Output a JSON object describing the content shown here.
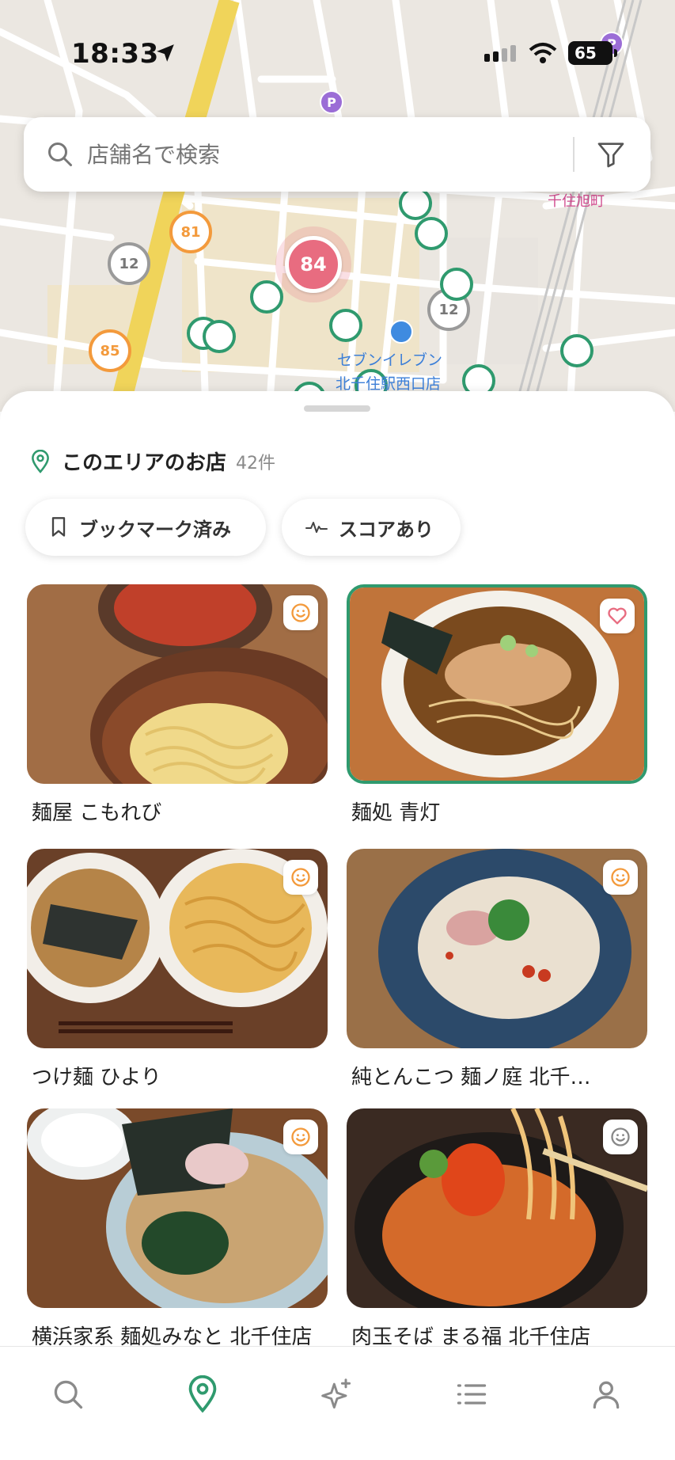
{
  "status_bar": {
    "time": "18:33",
    "battery": "65"
  },
  "search": {
    "placeholder": "店舗名で検索"
  },
  "map": {
    "pins_numbered": [
      "84",
      "81",
      "85",
      "12",
      "12"
    ],
    "labels": {
      "store": "セブンイレブン",
      "store_branch": "北千住駅西口店",
      "district": "千住旭町"
    },
    "parking_label": "P"
  },
  "sheet": {
    "area_title": "このエリアのお店",
    "area_count": "42件",
    "chips": [
      {
        "label": "ブックマーク済み",
        "icon": "bookmark-icon"
      },
      {
        "label": "スコアあり",
        "icon": "pulse-icon"
      }
    ]
  },
  "shops": [
    {
      "name": "麺屋 こもれび",
      "badge": "smiley-icon"
    },
    {
      "name": "麺処 青灯",
      "badge": "heart-icon",
      "selected": true
    },
    {
      "name": "つけ麺 ひより",
      "badge": "smiley-icon"
    },
    {
      "name": "純とんこつ 麺ノ庭 北千…",
      "badge": "smiley-icon"
    },
    {
      "name": "横浜家系 麺処みなと 北千住店",
      "badge": "smiley-icon"
    },
    {
      "name": "肉玉そば まる福 北千住店",
      "badge": "smiley-gray-icon"
    }
  ],
  "nav": [
    {
      "icon": "search-icon",
      "active": false
    },
    {
      "icon": "map-pin-icon",
      "active": true
    },
    {
      "icon": "sparkle-icon",
      "active": false
    },
    {
      "icon": "list-icon",
      "active": false
    },
    {
      "icon": "profile-icon",
      "active": false
    }
  ],
  "colors": {
    "accent": "#2f9a6e",
    "orange": "#f39a3c",
    "red_cluster": "#e86c80"
  }
}
